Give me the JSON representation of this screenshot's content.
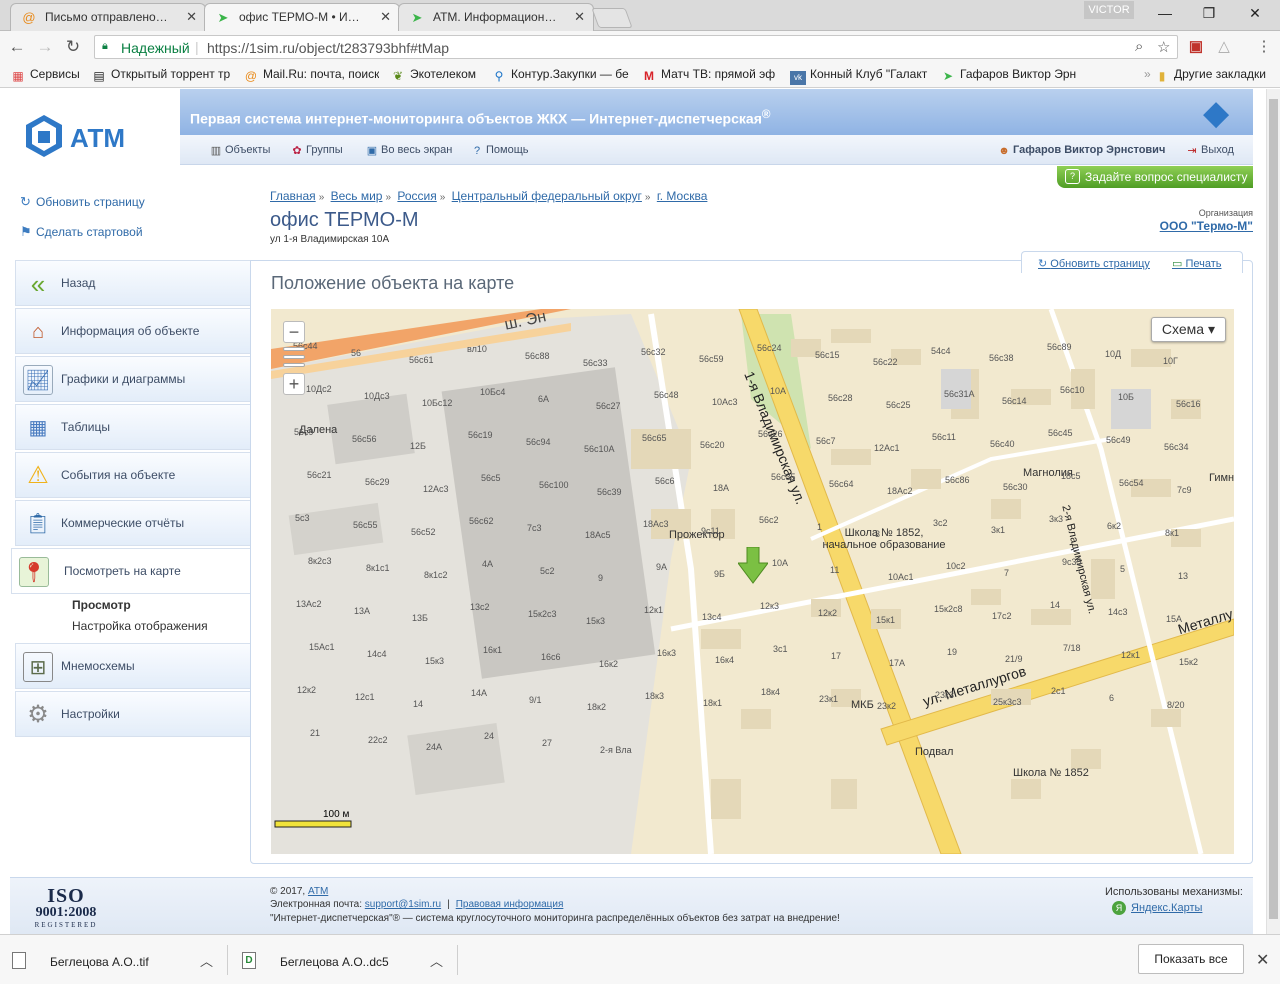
{
  "browser": {
    "tabs": [
      {
        "title": "Письмо отправлено - П",
        "icon": "mail-at-icon",
        "active": false
      },
      {
        "title": "офис ТЕРМО-М • Интер",
        "icon": "green-arrow-icon",
        "active": true
      },
      {
        "title": "АТМ. Информационный",
        "icon": "green-arrow-icon",
        "active": false
      }
    ],
    "profile": "VICTOR",
    "secure_label": "Надежный",
    "url": "https://1sim.ru/object/t283793bhf#tMap",
    "bookmarks": [
      {
        "label": "Сервисы",
        "icon": "apps-grid-icon"
      },
      {
        "label": "Открытый торрент тр",
        "icon": "film-icon"
      },
      {
        "label": "Mail.Ru: почта, поиск",
        "icon": "mail-at-icon"
      },
      {
        "label": "Экотелеком",
        "icon": "leaf-icon"
      },
      {
        "label": "Контур.Закупки — бе",
        "icon": "pin-icon"
      },
      {
        "label": "Матч ТВ: прямой эф",
        "icon": "m-icon"
      },
      {
        "label": "Конный Клуб \"Галакт",
        "icon": "vk-icon"
      },
      {
        "label": "Гафаров Виктор Эрн",
        "icon": "green-arrow-icon"
      }
    ],
    "other_bookmarks": "Другие закладки"
  },
  "header": {
    "slogan": "Первая система интернет-мониторинга объектов ЖКХ — Интернет-диспетчерская",
    "slogan_mark": "®",
    "logo_text": "АТМ",
    "menu": [
      {
        "label": "Объекты",
        "icon": "objects-icon"
      },
      {
        "label": "Группы",
        "icon": "groups-icon"
      },
      {
        "label": "Во весь экран",
        "icon": "fullscreen-icon"
      },
      {
        "label": "Помощь",
        "icon": "help-icon"
      }
    ],
    "user": "Гафаров Виктор Эрнстович",
    "logout": "Выход",
    "ask_button": "Задайте вопрос специалисту"
  },
  "quick_links": [
    "Обновить страницу",
    "Сделать стартовой"
  ],
  "breadcrumb": [
    "Главная",
    "Весь мир",
    "Россия",
    "Центральный федеральный округ",
    "г. Москва"
  ],
  "object": {
    "title": "офис ТЕРМО-М",
    "address": "ул 1-я Владимирская 10А"
  },
  "organization": {
    "label": "Организация",
    "name": "ООО \"Термо-М\""
  },
  "sidebar": {
    "items": [
      {
        "label": "Назад",
        "icon": "back-arrows-icon",
        "color": "#6aa832"
      },
      {
        "label": "Информация об объекте",
        "icon": "house-icon",
        "color": "#c0582b"
      },
      {
        "label": "Графики и диаграммы",
        "icon": "chart-icon",
        "color": "#3a6fb5"
      },
      {
        "label": "Таблицы",
        "icon": "table-icon",
        "color": "#4a7cc0"
      },
      {
        "label": "События на объекте",
        "icon": "warning-icon",
        "color": "#f0b21a"
      },
      {
        "label": "Коммерческие отчёты",
        "icon": "clipboard-icon",
        "color": "#2f6aa8"
      },
      {
        "label": "Посмотреть на карте",
        "icon": "map-pin-icon",
        "color": "#d63b2d"
      },
      {
        "label": "Мнемосхемы",
        "icon": "mnemo-icon",
        "color": "#5b6b4a"
      },
      {
        "label": "Настройки",
        "icon": "gear-icon",
        "color": "#8a8a8a"
      }
    ],
    "sub_items": [
      {
        "label": "Просмотр",
        "bold": true
      },
      {
        "label": "Настройка отображения",
        "bold": false
      }
    ]
  },
  "content": {
    "title": "Положение объекта на карте",
    "refresh": "Обновить страницу",
    "print": "Печать"
  },
  "map": {
    "layer_button": "Схема ▾",
    "scale_label": "100 м",
    "streets": [
      "1-я Владимирская ул.",
      "ул. Металлургов",
      "2-я Владимирская ул.",
      "Металлу",
      "ш. Эн"
    ],
    "pois": [
      "Далена",
      "Прожектор",
      "Школа № 1852, начальное образование",
      "Магнолия",
      "МКБ",
      "Подвал",
      "Школа № 1852",
      "Гимн"
    ],
    "buildings": [
      "56с44",
      "56",
      "56с61",
      "вл10",
      "56с88",
      "56с33",
      "56с32",
      "56с59",
      "56с24",
      "56с15",
      "56с22",
      "54с4",
      "56с38",
      "56с89",
      "10Д",
      "10Г",
      "10Дс2",
      "10Дс3",
      "10Бс12",
      "10Бс4",
      "6А",
      "56с27",
      "56с48",
      "10Ас3",
      "10А",
      "56с28",
      "56с25",
      "56с31А",
      "56с14",
      "56с10",
      "10Б",
      "56с16",
      "56с9",
      "56с56",
      "12Б",
      "56с19",
      "56с94",
      "56с10А",
      "56с65",
      "56с20",
      "56с26",
      "56с7",
      "12Ас1",
      "56с11",
      "56с40",
      "56с45",
      "56с49",
      "56с34",
      "56с21",
      "56с29",
      "12Ас3",
      "56с5",
      "56с100",
      "56с39",
      "56с6",
      "18А",
      "56с35",
      "56с64",
      "18Ас2",
      "56с86",
      "56с30",
      "18с5",
      "56с54",
      "7с9",
      "5с3",
      "56с55",
      "56с52",
      "56с62",
      "7с3",
      "18Ас5",
      "18Ас3",
      "9с11",
      "56с2",
      "1",
      "3",
      "3с2",
      "3к1",
      "3к3",
      "6к2",
      "8к1",
      "8к2с3",
      "8к1с1",
      "8к1с2",
      "4А",
      "5с2",
      "9",
      "9А",
      "9Б",
      "10А",
      "11",
      "10Ас1",
      "10с2",
      "7",
      "9с35",
      "5",
      "13",
      "13Ас2",
      "13А",
      "13Б",
      "13с2",
      "15к2с3",
      "15к3",
      "12к1",
      "13с4",
      "12к3",
      "12к2",
      "15к1",
      "15к2с8",
      "17с2",
      "14",
      "14с3",
      "15А",
      "15Ас1",
      "14с4",
      "15к3",
      "16к1",
      "16с6",
      "16к2",
      "16к3",
      "16к4",
      "3с1",
      "17",
      "17А",
      "19",
      "21/9",
      "7/18",
      "12к1",
      "15к2",
      "12к2",
      "12с1",
      "14",
      "14А",
      "9/1",
      "18к2",
      "18к3",
      "18к1",
      "18к4",
      "23к1",
      "23к2",
      "23к3",
      "25к3с3",
      "2с1",
      "6",
      "8/20",
      "21",
      "22с2",
      "24А",
      "24",
      "27",
      "2-я Вла"
    ]
  },
  "footer": {
    "copyright": "© 2017, ",
    "copyright_link": "АТМ",
    "email_label": "Электронная почта: ",
    "email": "support@1sim.ru",
    "legal": "Правовая информация",
    "tagline": "\"Интернет-диспетчерская\"® — система круглосуточного мониторинга распределённых объектов без затрат на внедрение!",
    "engines_label": "Использованы механизмы:",
    "engine": "Яндекс.Карты",
    "iso_top": "ISO",
    "iso_mid": "9001:2008",
    "iso_bottom": "REGISTERED"
  },
  "downloads": {
    "items": [
      {
        "name": "Беглецова А.О..tif",
        "icon": "tif-file-icon"
      },
      {
        "name": "Беглецова А.О..dc5",
        "icon": "dc5-file-icon"
      }
    ],
    "show_all": "Показать все"
  }
}
